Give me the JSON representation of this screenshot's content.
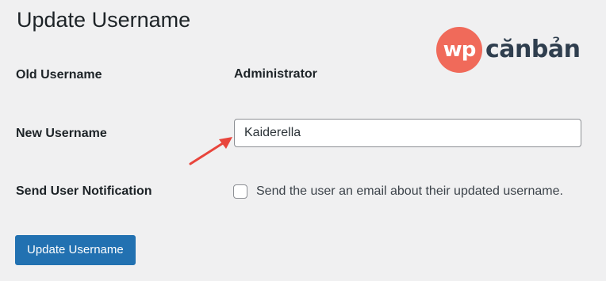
{
  "page": {
    "title": "Update Username"
  },
  "logo": {
    "badge_text": "wp",
    "text": "cănbản",
    "badge_color": "#f06a5a",
    "text_color": "#2f3e4e"
  },
  "form": {
    "old_username": {
      "label": "Old Username",
      "value": "Administrator"
    },
    "new_username": {
      "label": "New Username",
      "value": "Kaiderella"
    },
    "notification": {
      "label": "Send User Notification",
      "checkbox_text": "Send the user an email about their updated username.",
      "checked": false
    },
    "submit_label": "Update Username"
  },
  "annotation": {
    "arrow_color": "#e8453c",
    "arrow_icon": "arrow-pointing-icon"
  },
  "colors": {
    "background": "#f0f0f1",
    "primary_button": "#2271b1"
  }
}
